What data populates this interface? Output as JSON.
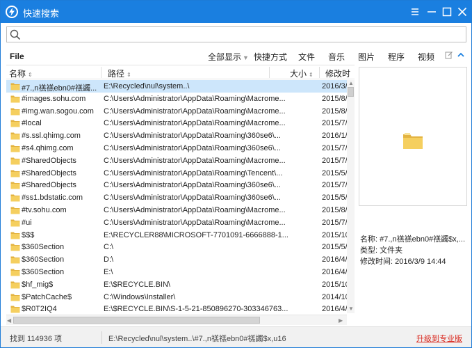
{
  "window": {
    "title": "快速搜索"
  },
  "search": {
    "value": "",
    "placeholder": ""
  },
  "filterbar": {
    "file_label": "File",
    "tabs": [
      {
        "label": "全部显示",
        "active": true
      },
      {
        "label": "快捷方式"
      },
      {
        "label": "文件"
      },
      {
        "label": "音乐"
      },
      {
        "label": "图片"
      },
      {
        "label": "程序"
      },
      {
        "label": "视频"
      }
    ]
  },
  "columns": {
    "name": "名称",
    "path": "路径",
    "size": "大小",
    "date": "修改时"
  },
  "rows": [
    {
      "name": "#7.,n禚禚ebn0#禚蠲...",
      "path": "E:\\Recycled\\nul\\system..\\",
      "date": "2016/3/",
      "selected": true
    },
    {
      "name": "#images.sohu.com",
      "path": "C:\\Users\\Administrator\\AppData\\Roaming\\Macrome...",
      "date": "2015/8/"
    },
    {
      "name": "#img.wan.sogou.com",
      "path": "C:\\Users\\Administrator\\AppData\\Roaming\\Macrome...",
      "date": "2015/8/"
    },
    {
      "name": "#local",
      "path": "C:\\Users\\Administrator\\AppData\\Roaming\\Macrome...",
      "date": "2015/7/"
    },
    {
      "name": "#s.ssl.qhimg.com",
      "path": "C:\\Users\\Administrator\\AppData\\Roaming\\360se6\\...",
      "date": "2016/1/"
    },
    {
      "name": "#s4.qhimg.com",
      "path": "C:\\Users\\Administrator\\AppData\\Roaming\\360se6\\...",
      "date": "2015/7/"
    },
    {
      "name": "#SharedObjects",
      "path": "C:\\Users\\Administrator\\AppData\\Roaming\\Macrome...",
      "date": "2015/7/"
    },
    {
      "name": "#SharedObjects",
      "path": "C:\\Users\\Administrator\\AppData\\Roaming\\Tencent\\...",
      "date": "2015/5/"
    },
    {
      "name": "#SharedObjects",
      "path": "C:\\Users\\Administrator\\AppData\\Roaming\\360se6\\...",
      "date": "2015/7/"
    },
    {
      "name": "#ss1.bdstatic.com",
      "path": "C:\\Users\\Administrator\\AppData\\Roaming\\360se6\\...",
      "date": "2015/5/"
    },
    {
      "name": "#tv.sohu.com",
      "path": "C:\\Users\\Administrator\\AppData\\Roaming\\Macrome...",
      "date": "2015/8/"
    },
    {
      "name": "#ui",
      "path": "C:\\Users\\Administrator\\AppData\\Roaming\\Macrome...",
      "date": "2015/7/"
    },
    {
      "name": "$$$",
      "path": "E:\\RECYCLER88\\MICROSOFT-7701091-6666888-1...",
      "date": "2015/10"
    },
    {
      "name": "$360Section",
      "path": "C:\\",
      "date": "2015/5/"
    },
    {
      "name": "$360Section",
      "path": "D:\\",
      "date": "2016/4/"
    },
    {
      "name": "$360Section",
      "path": "E:\\",
      "date": "2016/4/"
    },
    {
      "name": "$hf_mig$",
      "path": "E:\\$RECYCLE.BIN\\",
      "date": "2015/10"
    },
    {
      "name": "$PatchCache$",
      "path": "C:\\Windows\\Installer\\",
      "date": "2014/10"
    },
    {
      "name": "$R0T2IQ4",
      "path": "E:\\$RECYCLE.BIN\\S-1-5-21-850896270-303346763...",
      "date": "2016/4/"
    }
  ],
  "preview": {
    "name_label": "名称:",
    "name_value": "#7.,n禚禚ebn0#禚蠲$x,...",
    "type_label": "类型:",
    "type_value": "文件夹",
    "mtime_label": "修改时间:",
    "mtime_value": "2016/3/9 14:44"
  },
  "status": {
    "count": "找到 114936 项",
    "path": "E:\\Recycled\\nul\\system..\\#7.,n禚禚ebn0#禚蠲$x,u16",
    "upgrade": "升级到专业版"
  },
  "colors": {
    "titlebar": "#1a7fe0",
    "accent_tab": "#e86a28",
    "upgrade": "#d9261c",
    "selected_row": "#cde6fb"
  },
  "icons": [
    "app-bolt-icon",
    "menu-icon",
    "minimize-icon",
    "maximize-icon",
    "close-icon",
    "search-icon",
    "edit-icon",
    "collapse-up-icon",
    "folder-icon"
  ]
}
